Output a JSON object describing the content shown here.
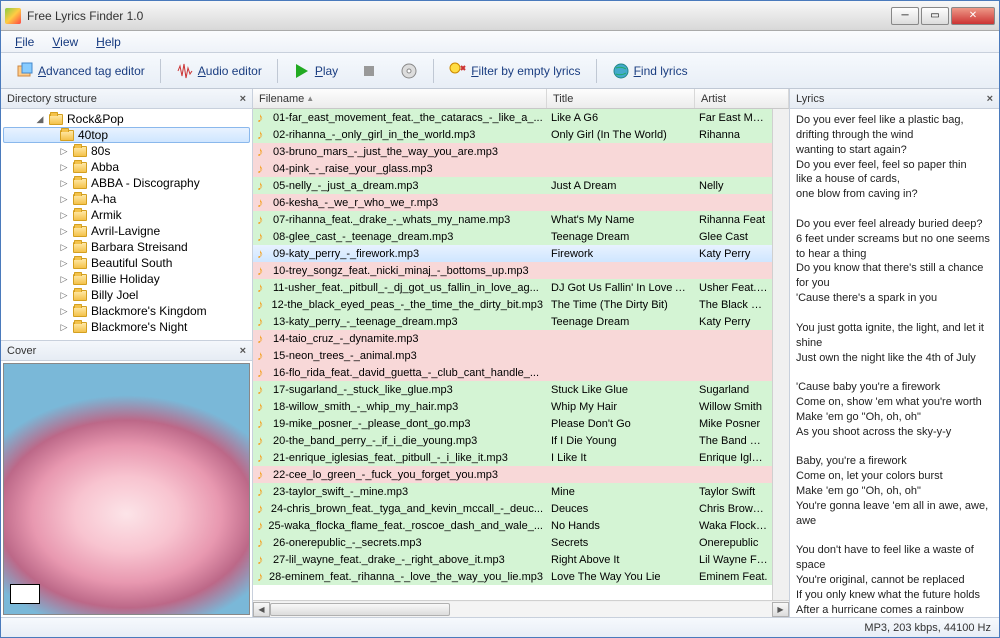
{
  "window": {
    "title": "Free Lyrics Finder 1.0"
  },
  "menu": [
    "File",
    "View",
    "Help"
  ],
  "toolbar": {
    "adv": "Advanced tag editor",
    "audio": "Audio editor",
    "play": "Play",
    "filter": "Filter by empty lyrics",
    "find": "Find lyrics"
  },
  "panels": {
    "dir_title": "Directory structure",
    "cover_title": "Cover",
    "lyrics_title": "Lyrics"
  },
  "tree": {
    "root": "Rock&Pop",
    "selected": "40top",
    "items": [
      "80s",
      "Abba",
      "ABBA - Discography",
      "A-ha",
      "Armik",
      "Avril-Lavigne",
      "Barbara Streisand",
      "Beautiful South",
      "Billie Holiday",
      "Billy Joel",
      "Blackmore's Kingdom",
      "Blackmore's Night"
    ]
  },
  "columns": {
    "filename": "Filename",
    "title": "Title",
    "artist": "Artist"
  },
  "rows": [
    {
      "fn": "01-far_east_movement_feat._the_cataracs_-_like_a_...",
      "ti": "Like A G6",
      "ar": "Far East Move",
      "cls": "green"
    },
    {
      "fn": "02-rihanna_-_only_girl_in_the_world.mp3",
      "ti": "Only Girl (In The World)",
      "ar": "Rihanna",
      "cls": "green"
    },
    {
      "fn": "03-bruno_mars_-_just_the_way_you_are.mp3",
      "ti": "",
      "ar": "",
      "cls": "pink"
    },
    {
      "fn": "04-pink_-_raise_your_glass.mp3",
      "ti": "",
      "ar": "",
      "cls": "pink"
    },
    {
      "fn": "05-nelly_-_just_a_dream.mp3",
      "ti": "Just A Dream",
      "ar": "Nelly",
      "cls": "green"
    },
    {
      "fn": "06-kesha_-_we_r_who_we_r.mp3",
      "ti": "",
      "ar": "",
      "cls": "pink"
    },
    {
      "fn": "07-rihanna_feat._drake_-_whats_my_name.mp3",
      "ti": "What's My Name",
      "ar": "Rihanna Feat",
      "cls": "green"
    },
    {
      "fn": "08-glee_cast_-_teenage_dream.mp3",
      "ti": "Teenage Dream",
      "ar": "Glee Cast",
      "cls": "green"
    },
    {
      "fn": "09-katy_perry_-_firework.mp3",
      "ti": "Firework",
      "ar": "Katy Perry",
      "cls": "sel"
    },
    {
      "fn": "10-trey_songz_feat._nicki_minaj_-_bottoms_up.mp3",
      "ti": "",
      "ar": "",
      "cls": "pink"
    },
    {
      "fn": "11-usher_feat._pitbull_-_dj_got_us_fallin_in_love_ag...",
      "ti": "DJ Got Us Fallin' In Love A...",
      "ar": "Usher Feat. Pi",
      "cls": "green"
    },
    {
      "fn": "12-the_black_eyed_peas_-_the_time_the_dirty_bit.mp3",
      "ti": "The Time (The Dirty Bit)",
      "ar": "The Black Eye",
      "cls": "green"
    },
    {
      "fn": "13-katy_perry_-_teenage_dream.mp3",
      "ti": "Teenage Dream",
      "ar": "Katy Perry",
      "cls": "green"
    },
    {
      "fn": "14-taio_cruz_-_dynamite.mp3",
      "ti": "",
      "ar": "",
      "cls": "pink"
    },
    {
      "fn": "15-neon_trees_-_animal.mp3",
      "ti": "",
      "ar": "",
      "cls": "pink"
    },
    {
      "fn": "16-flo_rida_feat._david_guetta_-_club_cant_handle_...",
      "ti": "",
      "ar": "",
      "cls": "pink"
    },
    {
      "fn": "17-sugarland_-_stuck_like_glue.mp3",
      "ti": "Stuck Like Glue",
      "ar": "Sugarland",
      "cls": "green"
    },
    {
      "fn": "18-willow_smith_-_whip_my_hair.mp3",
      "ti": "Whip My Hair",
      "ar": "Willow Smith",
      "cls": "green"
    },
    {
      "fn": "19-mike_posner_-_please_dont_go.mp3",
      "ti": "Please Don't Go",
      "ar": "Mike Posner",
      "cls": "green"
    },
    {
      "fn": "20-the_band_perry_-_if_i_die_young.mp3",
      "ti": "If I Die Young",
      "ar": "The Band Perr",
      "cls": "green"
    },
    {
      "fn": "21-enrique_iglesias_feat._pitbull_-_i_like_it.mp3",
      "ti": "I Like It",
      "ar": "Enrique Iglesia",
      "cls": "green"
    },
    {
      "fn": "22-cee_lo_green_-_fuck_you_forget_you.mp3",
      "ti": "",
      "ar": "",
      "cls": "pink"
    },
    {
      "fn": "23-taylor_swift_-_mine.mp3",
      "ti": "Mine",
      "ar": "Taylor Swift",
      "cls": "green"
    },
    {
      "fn": "24-chris_brown_feat._tyga_and_kevin_mccall_-_deuc...",
      "ti": "Deuces",
      "ar": "Chris Brown Fe",
      "cls": "green"
    },
    {
      "fn": "25-waka_flocka_flame_feat._roscoe_dash_and_wale_...",
      "ti": "No Hands",
      "ar": "Waka Flocka Fl",
      "cls": "green"
    },
    {
      "fn": "26-onerepublic_-_secrets.mp3",
      "ti": "Secrets",
      "ar": "Onerepublic",
      "cls": "green"
    },
    {
      "fn": "27-lil_wayne_feat._drake_-_right_above_it.mp3",
      "ti": "Right Above It",
      "ar": "Lil Wayne Fea",
      "cls": "green"
    },
    {
      "fn": "28-eminem_feat._rihanna_-_love_the_way_you_lie.mp3",
      "ti": "Love The Way You Lie",
      "ar": "Eminem Feat.",
      "cls": "green"
    }
  ],
  "lyrics": "Do you ever feel like a plastic bag,\ndrifting through the wind\nwanting to start again?\nDo you ever feel, feel so paper thin\nlike a house of cards,\none blow from caving in?\n\nDo you ever feel already buried deep?\n6 feet under screams but no one seems to hear a thing\nDo you know that there's still a chance for you\n'Cause there's a spark in you\n\nYou just gotta ignite, the light, and let it shine\nJust own the night like the 4th of July\n\n'Cause baby you're a firework\nCome on, show 'em what you're worth\nMake 'em go \"Oh, oh, oh\"\nAs you shoot across the sky-y-y\n\nBaby, you're a firework\nCome on, let your colors burst\nMake 'em go \"Oh, oh, oh\"\nYou're gonna leave 'em all in awe, awe, awe\n\nYou don't have to feel like a waste of space\nYou're original, cannot be replaced\nIf you only knew what the future holds\nAfter a hurricane comes a rainbow",
  "status": "MP3, 203 kbps, 44100 Hz"
}
